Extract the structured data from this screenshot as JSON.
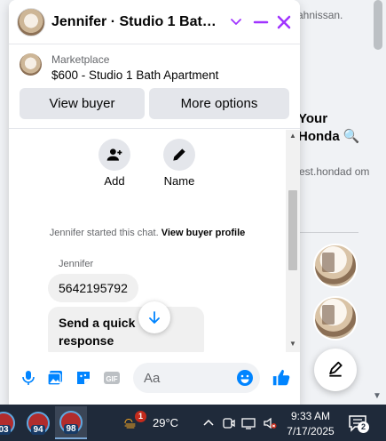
{
  "chat": {
    "title": "Jennifer · Studio 1 Bath Ap...",
    "listing": {
      "source": "Marketplace",
      "title": "$600 - Studio 1 Bath Apartment"
    },
    "buttons": {
      "view_buyer": "View buyer",
      "more_options": "More options"
    },
    "actions": {
      "add": "Add",
      "name": "Name"
    },
    "system_message": {
      "text": "Jennifer started this chat.",
      "link": "View buyer profile"
    },
    "sender": "Jennifer",
    "messages": [
      "5642195792",
      "Send a quick response"
    ],
    "composer": {
      "placeholder": "Aa"
    },
    "accent_color": "#a033ff",
    "messenger_blue": "#0084ff"
  },
  "background": {
    "name_fragment": "ahnissan.",
    "ad_title": "Your Honda 🔍",
    "ad_site": "est.hondad om"
  },
  "taskbar": {
    "apps": [
      "03",
      "94",
      "98"
    ],
    "weather": {
      "temp": "29°C",
      "alert_count": "1"
    },
    "time": "9:33 AM",
    "date": "7/17/2025",
    "notification_count": "2"
  }
}
